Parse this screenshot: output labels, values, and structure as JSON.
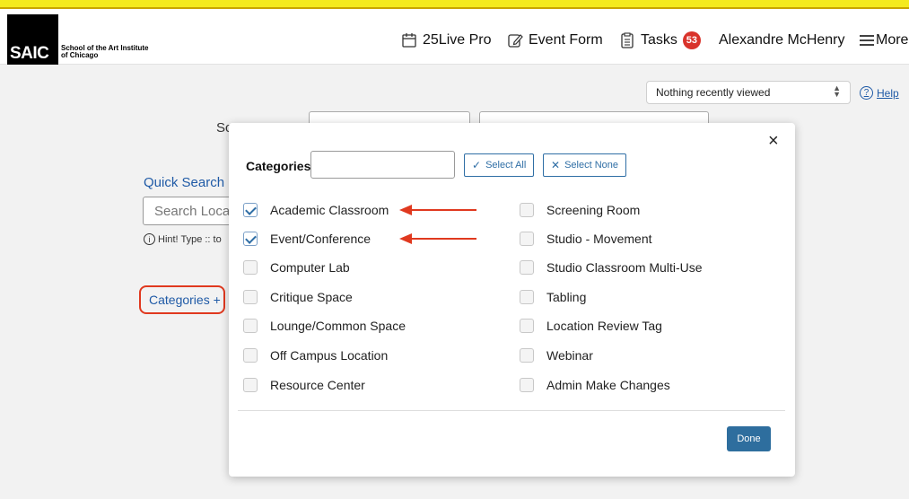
{
  "header": {
    "logo_mark": "SAIC",
    "logo_line1": "School of the Art Institute",
    "logo_line2": "of Chicago",
    "nav": {
      "live_pro": "25Live Pro",
      "event_form": "Event Form",
      "tasks": "Tasks",
      "tasks_count": "53",
      "user": "Alexandre McHenry",
      "more": "More"
    }
  },
  "toolbar": {
    "recent_value": "Nothing recently viewed",
    "help_label": "Help"
  },
  "search": {
    "select_object_label": "Sc",
    "quick_search_label": "Quick Search",
    "quick_search_placeholder": "Search Loca",
    "hint": "Hint! Type :: to",
    "categories_link": "Categories +"
  },
  "modal": {
    "close_glyph": "×",
    "categories_label": "Categories",
    "categories_filter_value": "",
    "select_all_label": "Select All",
    "select_none_label": "Select None",
    "done_label": "Done",
    "left_items": [
      {
        "label": "Academic Classroom",
        "checked": true
      },
      {
        "label": "Event/Conference",
        "checked": true
      },
      {
        "label": "Computer Lab",
        "checked": false
      },
      {
        "label": "Critique Space",
        "checked": false
      },
      {
        "label": "Lounge/Common Space",
        "checked": false
      },
      {
        "label": "Off Campus Location",
        "checked": false
      },
      {
        "label": "Resource Center",
        "checked": false
      }
    ],
    "right_items": [
      {
        "label": "Screening Room",
        "checked": false
      },
      {
        "label": "Studio - Movement",
        "checked": false
      },
      {
        "label": "Studio Classroom Multi-Use",
        "checked": false
      },
      {
        "label": "Tabling",
        "checked": false
      },
      {
        "label": "Location Review Tag",
        "checked": false
      },
      {
        "label": "Webinar",
        "checked": false
      },
      {
        "label": "Admin Make Changes",
        "checked": false
      }
    ]
  },
  "colors": {
    "accent_blue": "#2f6ea5",
    "annotation_red": "#e0391f",
    "badge_red": "#d9332b",
    "top_stripe": "#f4ea1e"
  }
}
